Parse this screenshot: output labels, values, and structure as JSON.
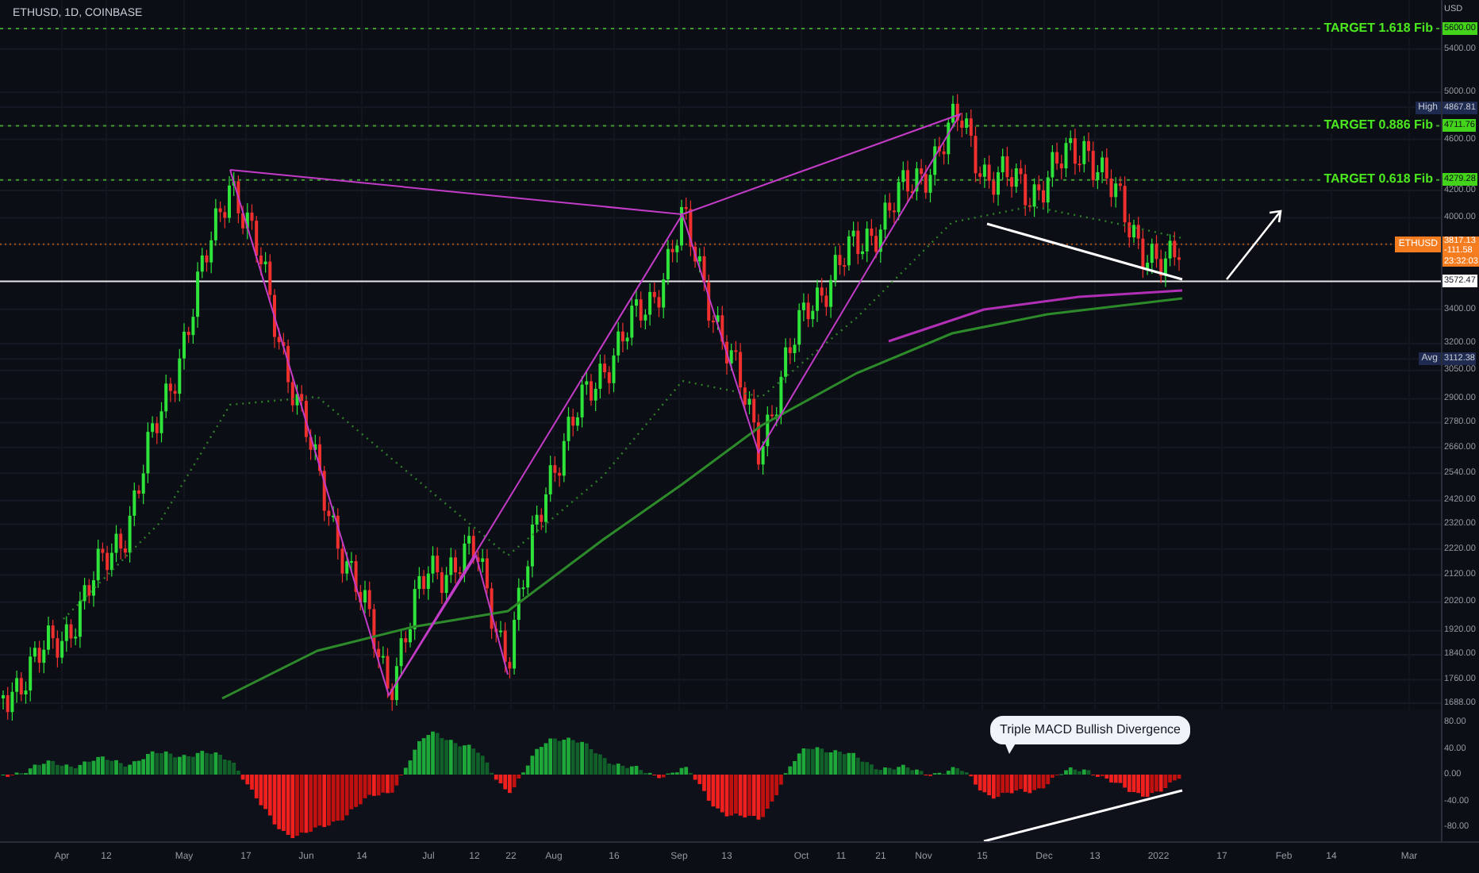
{
  "header": {
    "symbol": "ETHUSD, 1D, COINBASE"
  },
  "price_axis": {
    "unit": "USD",
    "labels": [
      {
        "kind": "target",
        "value": "5600.00",
        "caption": "TARGET  1.618 Fib"
      },
      {
        "kind": "tick",
        "value": "5400.00"
      },
      {
        "kind": "tick",
        "value": "5000.00"
      },
      {
        "kind": "high",
        "tag": "High",
        "value": "4867.81"
      },
      {
        "kind": "target",
        "value": "4711.76",
        "caption": "TARGET  0.886 Fib"
      },
      {
        "kind": "tick",
        "value": "4600.00"
      },
      {
        "kind": "target",
        "value": "4279.28",
        "caption": "TARGET  0.618 Fib"
      },
      {
        "kind": "tick",
        "value": "4200.00"
      },
      {
        "kind": "tick",
        "value": "4000.00"
      },
      {
        "kind": "last",
        "tag": "ETHUSD",
        "value": "3817.13",
        "lines": [
          "-111.58",
          "23:32:03"
        ]
      },
      {
        "kind": "line",
        "value": "3572.47"
      },
      {
        "kind": "tick",
        "value": "3400.00"
      },
      {
        "kind": "tick",
        "value": "3200.00"
      },
      {
        "kind": "avg",
        "tag": "Avg",
        "value": "3112.38"
      },
      {
        "kind": "tick",
        "value": "3050.00"
      },
      {
        "kind": "tick",
        "value": "2900.00"
      },
      {
        "kind": "tick",
        "value": "2780.00"
      },
      {
        "kind": "tick",
        "value": "2660.00"
      },
      {
        "kind": "tick",
        "value": "2540.00"
      },
      {
        "kind": "tick",
        "value": "2420.00"
      },
      {
        "kind": "tick",
        "value": "2320.00"
      },
      {
        "kind": "tick",
        "value": "2220.00"
      },
      {
        "kind": "tick",
        "value": "2120.00"
      },
      {
        "kind": "tick",
        "value": "2020.00"
      },
      {
        "kind": "tick",
        "value": "1920.00"
      },
      {
        "kind": "tick",
        "value": "1840.00"
      },
      {
        "kind": "tick",
        "value": "1760.00"
      },
      {
        "kind": "tick",
        "value": "1688.00"
      }
    ]
  },
  "macd": {
    "callout": "Triple MACD Bullish Divergence",
    "axis": [
      "80.00",
      "40.00",
      "0.00",
      "-40.00",
      "-80.00"
    ]
  },
  "time_axis": [
    "Apr",
    "12",
    "May",
    "17",
    "Jun",
    "14",
    "Jul",
    "12",
    "22",
    "Aug",
    "16",
    "Sep",
    "13",
    "Oct",
    "11",
    "21",
    "Nov",
    "15",
    "Dec",
    "13",
    "2022",
    "17",
    "Feb",
    "14",
    "Mar"
  ]
}
